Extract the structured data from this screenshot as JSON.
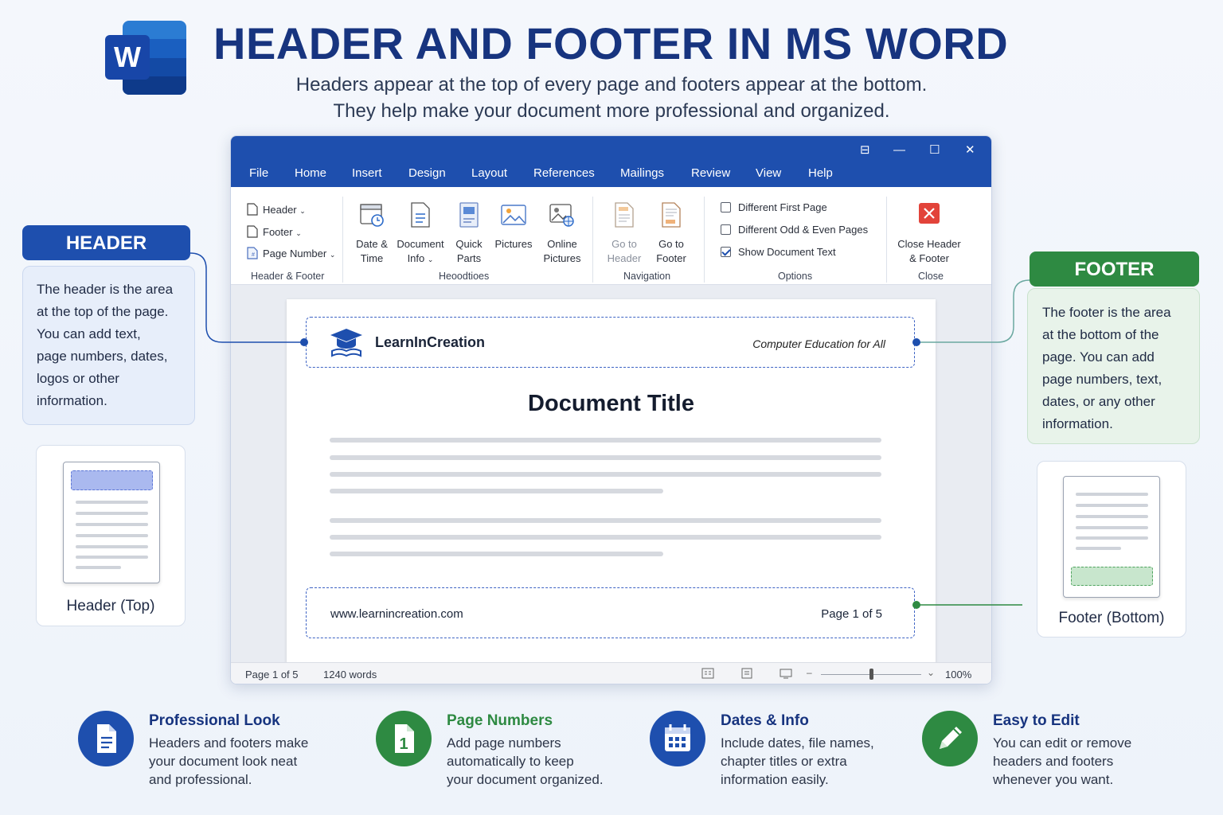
{
  "page": {
    "title": "HEADER AND FOOTER IN MS WORD",
    "subtitle_line1": "Headers appear at the top of every page and footers appear at the bottom.",
    "subtitle_line2": "They help make your document more professional and organized.",
    "logo_letter": "W"
  },
  "window": {
    "controls": {
      "restore": "⊟",
      "minimize": "—",
      "maximize": "☐",
      "close": "✕"
    },
    "menu": [
      "File",
      "Home",
      "Insert",
      "Design",
      "Layout",
      "References",
      "Mailings",
      "Review",
      "View",
      "Help"
    ],
    "ribbon": {
      "header_footer": {
        "header": "Header",
        "footer": "Footer",
        "page_number": "Page Number",
        "group": "Header & Footer"
      },
      "insert": {
        "date_time": [
          "Date &",
          "Time"
        ],
        "document_info": [
          "Document",
          "Info"
        ],
        "quick_parts": [
          "Quick",
          "Parts"
        ],
        "pictures": "Pictures",
        "online_pictures": [
          "Online",
          "Pictures"
        ],
        "group": "Heoodtioes"
      },
      "navigation": {
        "go_to_header": [
          "Go to",
          "Header"
        ],
        "go_to_footer": [
          "Go to",
          "Footer"
        ],
        "group": "Navigation"
      },
      "options": {
        "different_first_page": "Different First Page",
        "different_odd_even": "Different Odd & Even Pages",
        "show_document_text": "Show Document Text",
        "show_document_text_checked": true,
        "group": "Options"
      },
      "close": {
        "label": [
          "Close Header",
          "& Footer"
        ],
        "group": "Close"
      }
    },
    "document": {
      "header_brand": "LearnInCreation",
      "header_tagline": "Computer Education for All",
      "title": "Document Title",
      "footer_url": "www.learnincreation.com",
      "footer_page": "Page 1 of 5"
    },
    "status": {
      "page": "Page 1 of 5",
      "words": "1240 words",
      "zoom": "100%"
    }
  },
  "header_panel": {
    "badge": "HEADER",
    "text": [
      "The header is the area",
      "at the top of the page.",
      "You can add text,",
      "page numbers, dates,",
      "logos or other",
      "information."
    ],
    "card_label": "Header (Top)"
  },
  "footer_panel": {
    "badge": "FOOTER",
    "text": [
      "The footer is the area",
      "at the bottom of the",
      "page. You can add",
      "page numbers, text,",
      "dates, or any other",
      "information."
    ],
    "card_label": "Footer (Bottom)"
  },
  "features": [
    {
      "title": "Professional Look",
      "lines": [
        "Headers and footers make",
        "your document look neat",
        "and professional."
      ],
      "color": "#1e4fae",
      "icon": "document-icon"
    },
    {
      "title": "Page Numbers",
      "lines": [
        "Add page numbers",
        "automatically to keep",
        "your document organized."
      ],
      "color": "#2e8a42",
      "icon": "page-number-icon",
      "glyph": "1"
    },
    {
      "title": "Dates & Info",
      "lines": [
        "Include dates, file names,",
        "chapter titles or extra",
        "information easily."
      ],
      "color": "#1e4fae",
      "icon": "calendar-icon"
    },
    {
      "title": "Easy to Edit",
      "lines": [
        "You can edit or remove",
        "headers and footers",
        "whenever you want."
      ],
      "color": "#2e8a42",
      "icon": "pencil-icon"
    }
  ],
  "colors": {
    "brand_blue": "#1e4fae",
    "title_blue": "#17347f",
    "green": "#2e8a42"
  }
}
